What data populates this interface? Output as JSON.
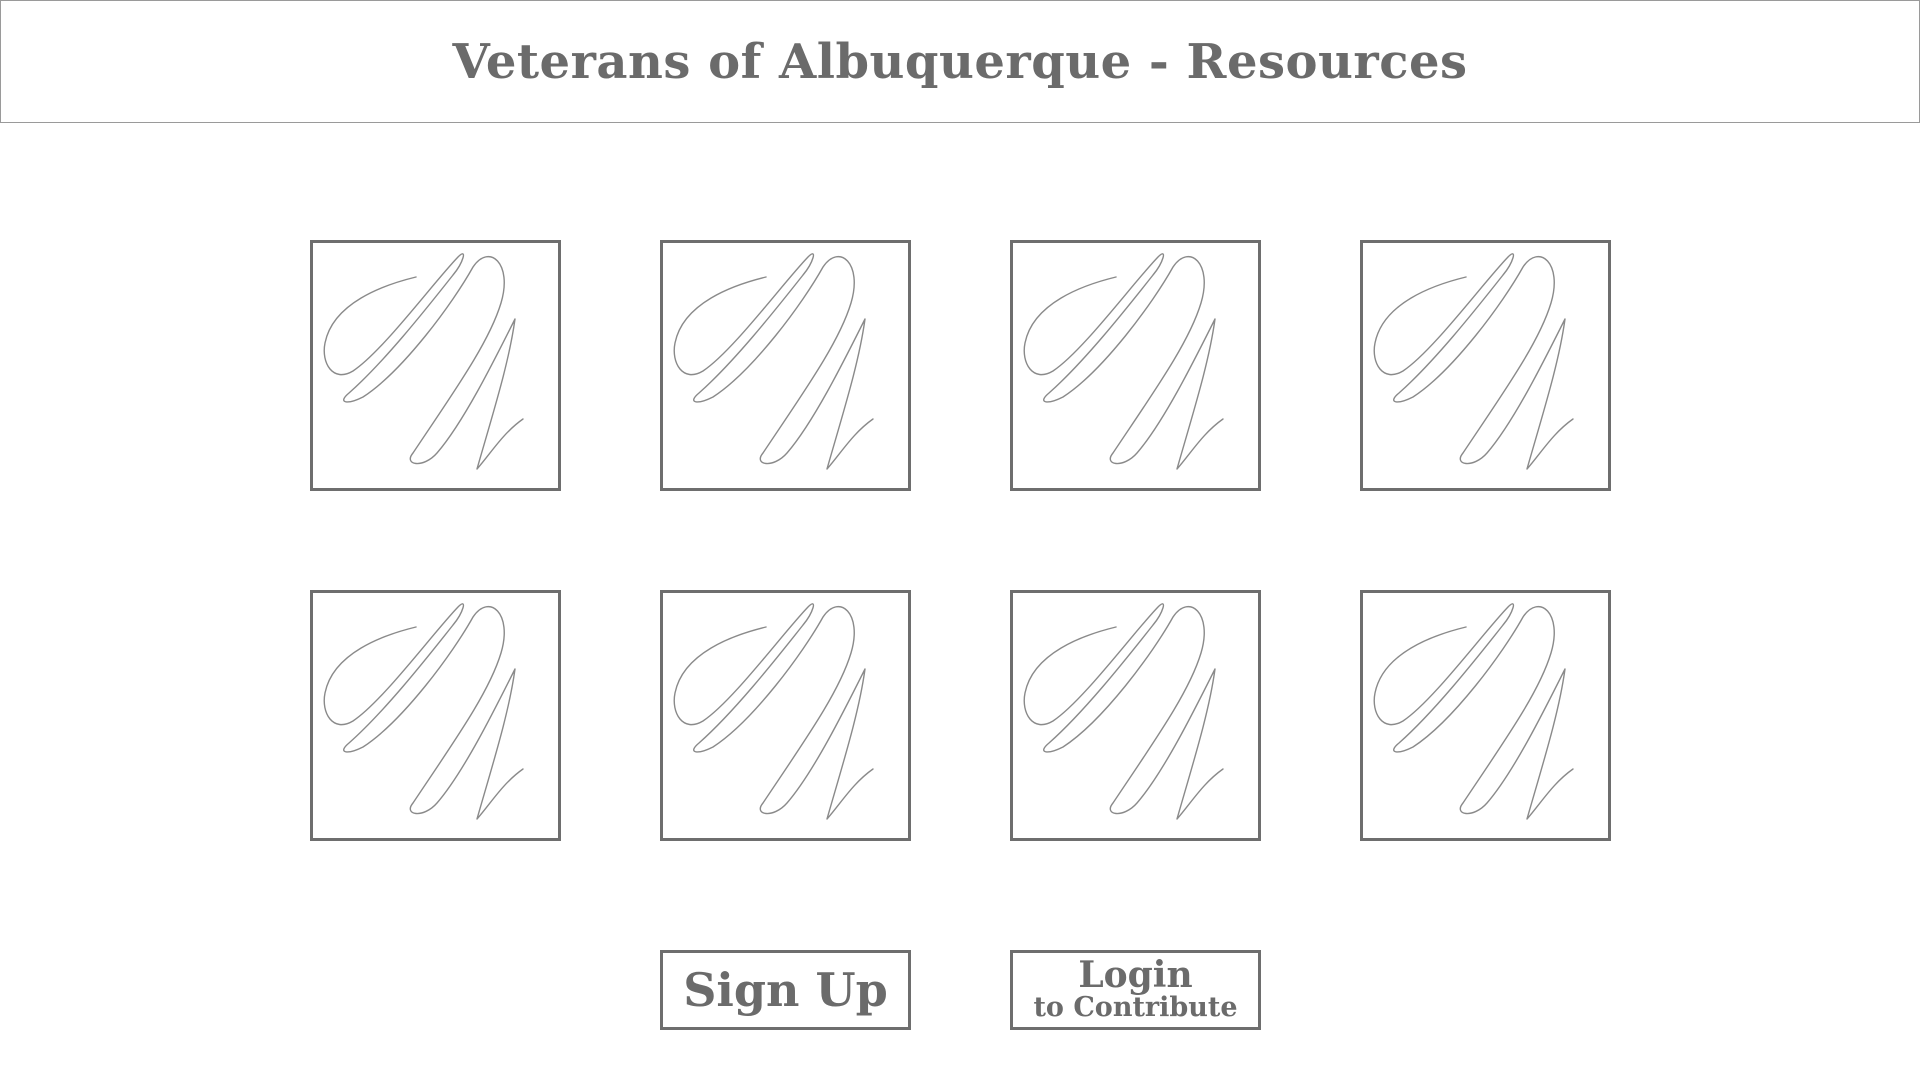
{
  "header": {
    "title": "Veterans of Albuquerque - Resources"
  },
  "tiles": [
    {
      "icon": "image-placeholder-icon"
    },
    {
      "icon": "image-placeholder-icon"
    },
    {
      "icon": "image-placeholder-icon"
    },
    {
      "icon": "image-placeholder-icon"
    },
    {
      "icon": "image-placeholder-icon"
    },
    {
      "icon": "image-placeholder-icon"
    },
    {
      "icon": "image-placeholder-icon"
    },
    {
      "icon": "image-placeholder-icon"
    }
  ],
  "buttons": {
    "signup_label": "Sign Up",
    "login_label": "Login",
    "login_sublabel": "to Contribute"
  },
  "colors": {
    "text": "#6b6b6b",
    "border": "#6e6e6e",
    "scribble": "#8a8a8a"
  }
}
